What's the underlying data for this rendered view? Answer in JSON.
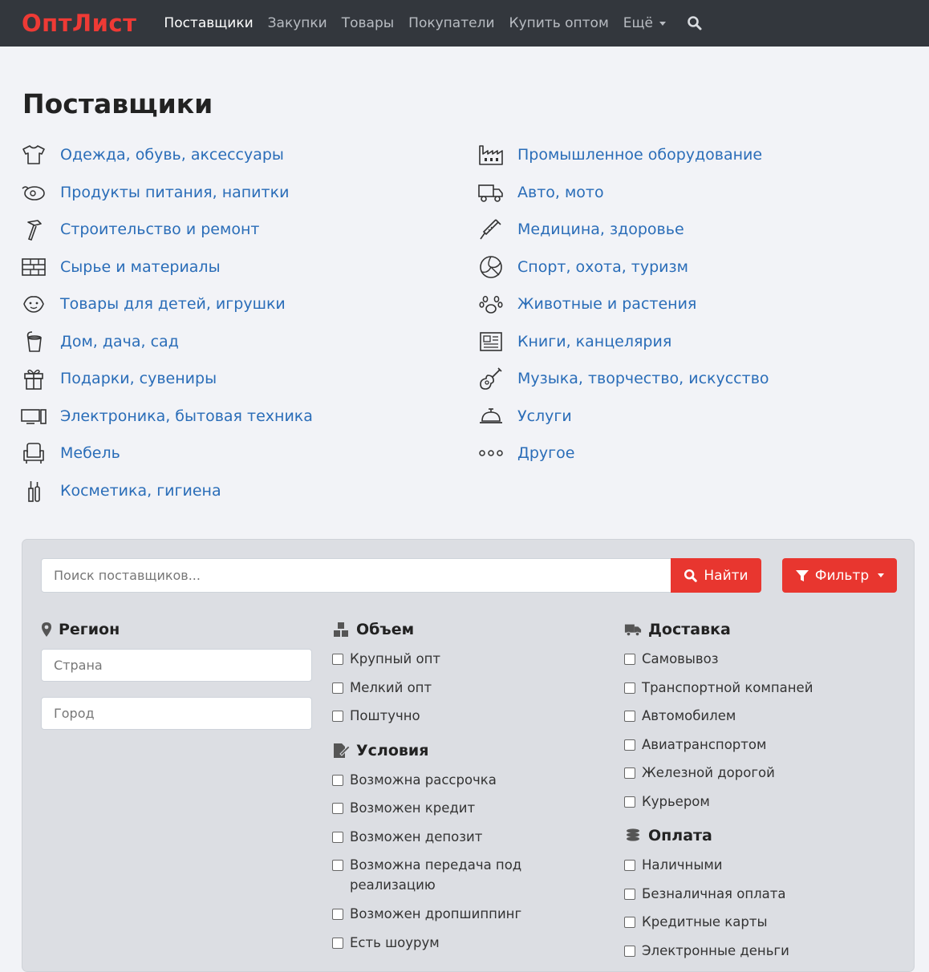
{
  "navbar": {
    "brand": "ОптЛист",
    "items": [
      "Поставщики",
      "Закупки",
      "Товары",
      "Покупатели",
      "Купить оптом"
    ],
    "more": "Ещё",
    "search_icon": "search-icon"
  },
  "page": {
    "title": "Поставщики"
  },
  "categories": {
    "left": [
      {
        "label": "Одежда, обувь, аксессуары",
        "icon": "tshirt-icon"
      },
      {
        "label": "Продукты питания, напитки",
        "icon": "food-icon"
      },
      {
        "label": "Строительство и ремонт",
        "icon": "hammer-icon"
      },
      {
        "label": "Сырье и материалы",
        "icon": "bricks-icon"
      },
      {
        "label": "Товары для детей, игрушки",
        "icon": "baby-icon"
      },
      {
        "label": "Дом, дача, сад",
        "icon": "bucket-icon"
      },
      {
        "label": "Подарки, сувениры",
        "icon": "gift-icon"
      },
      {
        "label": "Электроника, бытовая техника",
        "icon": "computer-icon"
      },
      {
        "label": "Мебель",
        "icon": "armchair-icon"
      },
      {
        "label": "Косметика, гигиена",
        "icon": "cosmetics-icon"
      }
    ],
    "right": [
      {
        "label": "Промышленное оборудование",
        "icon": "factory-icon"
      },
      {
        "label": "Авто, мото",
        "icon": "truck-icon"
      },
      {
        "label": "Медицина, здоровье",
        "icon": "syringe-icon"
      },
      {
        "label": "Спорт, охота, туризм",
        "icon": "volleyball-icon"
      },
      {
        "label": "Животные и растения",
        "icon": "paw-icon"
      },
      {
        "label": "Книги, канцелярия",
        "icon": "newspaper-icon"
      },
      {
        "label": "Музыка, творчество, искусство",
        "icon": "guitar-icon"
      },
      {
        "label": "Услуги",
        "icon": "service-bell-icon"
      },
      {
        "label": "Другое",
        "icon": "dots-icon"
      }
    ]
  },
  "filter": {
    "search_placeholder": "Поиск поставщиков...",
    "find_label": "Найти",
    "filter_label": "Фильтр",
    "region": {
      "title": "Регион",
      "country_placeholder": "Страна",
      "city_placeholder": "Город"
    },
    "volume": {
      "title": "Объем",
      "options": [
        "Крупный опт",
        "Мелкий опт",
        "Поштучно"
      ]
    },
    "conditions": {
      "title": "Условия",
      "options": [
        "Возможна рассрочка",
        "Возможен кредит",
        "Возможен депозит",
        "Возможна передача под реализацию",
        "Возможен дропшиппинг",
        "Есть шоурум"
      ]
    },
    "delivery": {
      "title": "Доставка",
      "options": [
        "Самовывоз",
        "Транспортной компаней",
        "Автомобилем",
        "Авиатранспортом",
        "Железной дорогой",
        "Курьером"
      ]
    },
    "payment": {
      "title": "Оплата",
      "options": [
        "Наличными",
        "Безналичная оплата",
        "Кредитные карты",
        "Электронные деньги"
      ]
    }
  },
  "colors": {
    "brand": "#ee3a35",
    "accent": "#e8362f",
    "link": "#2a6db8",
    "navbar": "#33373d"
  }
}
